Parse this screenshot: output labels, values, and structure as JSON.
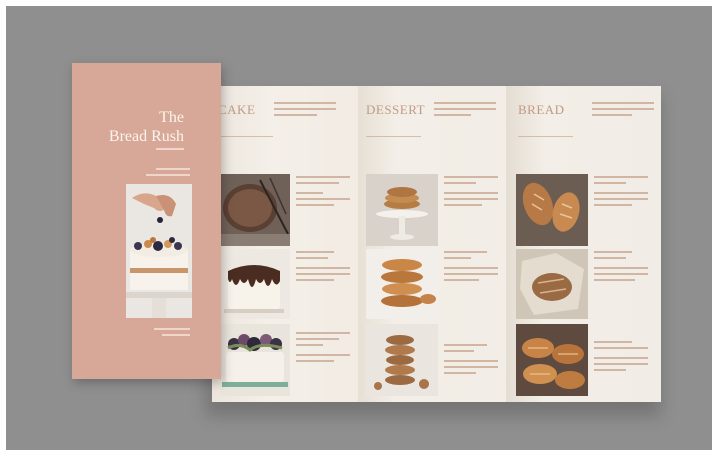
{
  "brochure": {
    "cover": {
      "title_line1": "The",
      "title_line2": "Bread Rush"
    },
    "sections": [
      {
        "heading": "CAKE"
      },
      {
        "heading": "DESSERT"
      },
      {
        "heading": "BREAD"
      }
    ]
  },
  "colors": {
    "background": "#8f8f8f",
    "cover": "#d7a897",
    "paper": "#f1ece4",
    "accent_text": "#c29a84"
  }
}
